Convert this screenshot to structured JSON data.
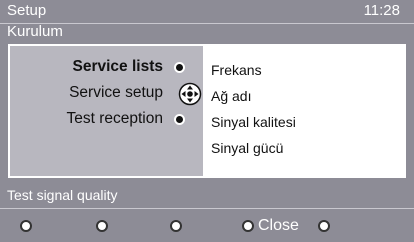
{
  "header": {
    "title": "Setup",
    "time": "11:28"
  },
  "subtitle": "Kurulum",
  "menu": {
    "items": [
      {
        "label": "Service lists",
        "selected": true
      },
      {
        "label": "Service setup",
        "selected": false
      },
      {
        "label": "Test reception",
        "selected": false
      }
    ]
  },
  "submenu": {
    "items": [
      "Frekans",
      "Ağ adı",
      "Sinyal kalitesi",
      "Sinyal gücü"
    ]
  },
  "status": {
    "text": "Test signal quality"
  },
  "footer": {
    "close_label": "Close"
  },
  "colors": {
    "background": "#8d8c96",
    "panel_left": "#b8b7bf",
    "text": "#ffffff"
  },
  "icons": [
    "navigation-cross-icon",
    "red-button-icon",
    "green-button-icon",
    "yellow-button-icon",
    "blue-button-icon"
  ]
}
